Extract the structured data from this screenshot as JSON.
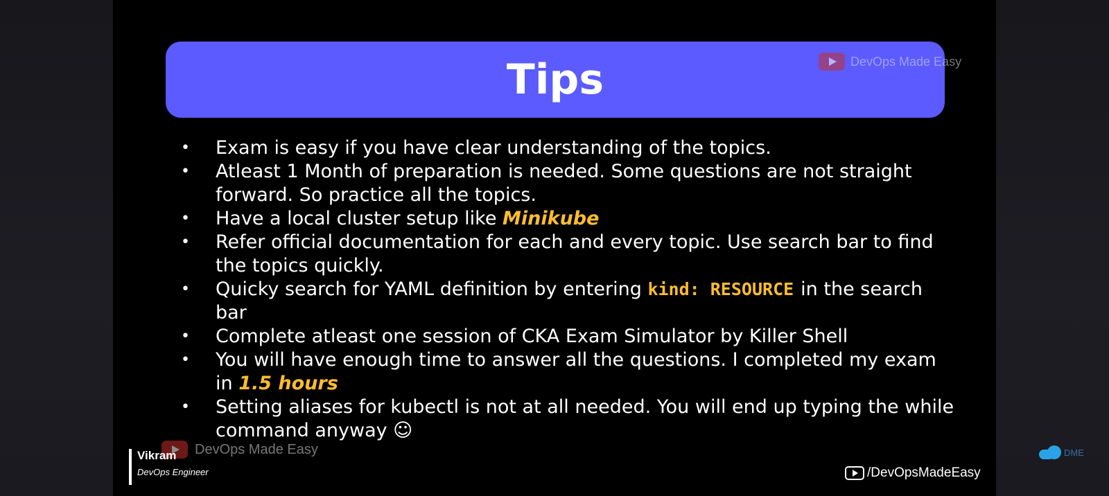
{
  "slide": {
    "title": "Tips",
    "watermark_top": "DevOps Made Easy",
    "tips": [
      {
        "parts": [
          {
            "text": "Exam is easy if you have clear understanding of the topics.",
            "style": "normal"
          }
        ]
      },
      {
        "parts": [
          {
            "text": "Atleast 1 Month of preparation is needed. Some questions are not straight forward. So practice all the topics.",
            "style": "normal"
          }
        ]
      },
      {
        "parts": [
          {
            "text": "Have a local cluster setup like ",
            "style": "normal"
          },
          {
            "text": "Minikube",
            "style": "highlight"
          }
        ]
      },
      {
        "parts": [
          {
            "text": "Refer official documentation for each and every topic. Use search bar to find the topics quickly.",
            "style": "normal"
          }
        ]
      },
      {
        "parts": [
          {
            "text": "Quicky search for YAML definition by entering ",
            "style": "normal"
          },
          {
            "text": "kind: RESOURCE",
            "style": "code"
          },
          {
            "text": "in the search bar",
            "style": "normal"
          }
        ]
      },
      {
        "parts": [
          {
            "text": "Complete atleast one session of CKA Exam Simulator by Killer Shell",
            "style": "normal"
          }
        ]
      },
      {
        "parts": [
          {
            "text": "You will have enough time to answer all the questions. I completed my exam in ",
            "style": "normal"
          },
          {
            "text": "1.5 hours",
            "style": "highlight"
          }
        ]
      },
      {
        "parts": [
          {
            "text": "Setting aliases for kubectl is not at all needed. You will end up typing the while command anyway ☺",
            "style": "normal"
          }
        ]
      }
    ],
    "presenter": {
      "name": "Vikram",
      "role": "DevOps Engineer"
    },
    "watermark_bottom": "DevOps Made Easy",
    "channel": "/DevOpsMadeEasy",
    "corner_logo_text": "DME"
  },
  "colors": {
    "title_bar": "#5b5bff",
    "highlight": "#ffbd2e",
    "slide_bg": "#000000",
    "youtube_red": "#c4302b"
  },
  "icons": [
    "youtube-logo-icon",
    "play-outline-icon",
    "cloud-logo-icon"
  ]
}
